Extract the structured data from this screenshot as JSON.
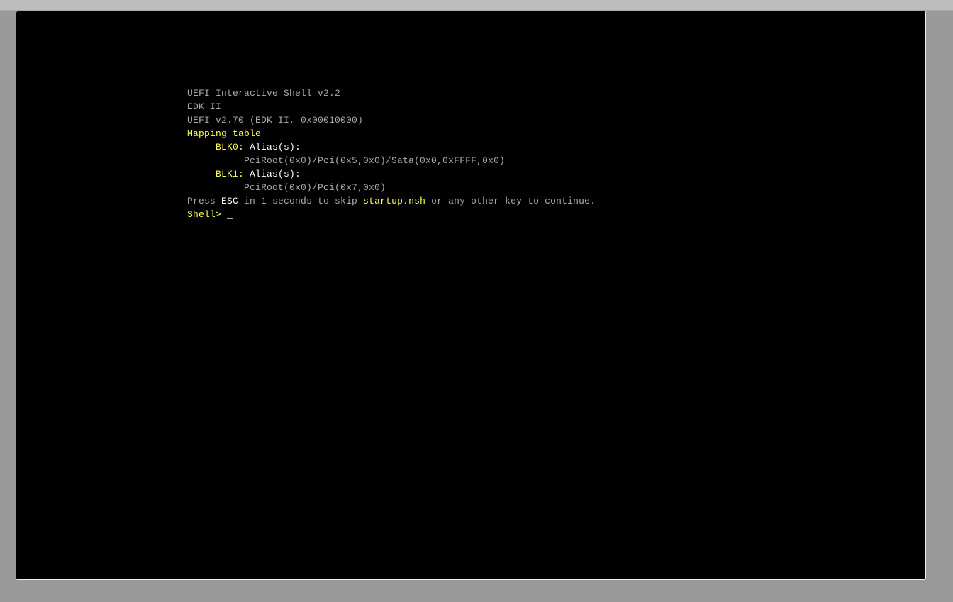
{
  "colors": {
    "gray": "#aaaaaa",
    "yellow": "#ffff55",
    "white": "#ffffff",
    "background": "#000000"
  },
  "console": {
    "line1": "UEFI Interactive Shell v2.2",
    "line2": "EDK II",
    "line3": "UEFI v2.70 (EDK II, 0x00010000)",
    "mapping_title": "Mapping table",
    "blk0": {
      "name": "BLK0:",
      "alias": " Alias(s):",
      "path": "PciRoot(0x0)/Pci(0x5,0x0)/Sata(0x0,0xFFFF,0x0)"
    },
    "blk1": {
      "name": "BLK1:",
      "alias": " Alias(s):",
      "path": "PciRoot(0x0)/Pci(0x7,0x0)"
    },
    "press": {
      "prefix": "Press ",
      "key": "ESC",
      "middle": " in 1 seconds to skip ",
      "file": "startup.nsh",
      "suffix": " or any other key to continue."
    },
    "prompt": "Shell> "
  }
}
